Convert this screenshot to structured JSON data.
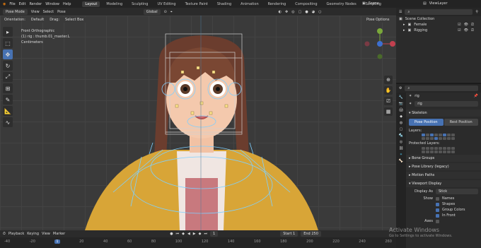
{
  "menus": [
    "File",
    "Edit",
    "Render",
    "Window",
    "Help"
  ],
  "workspace_tabs": [
    {
      "label": "Layout",
      "active": true
    },
    {
      "label": "Modeling"
    },
    {
      "label": "Sculpting"
    },
    {
      "label": "UV Editing"
    },
    {
      "label": "Texture Paint"
    },
    {
      "label": "Shading"
    },
    {
      "label": "Animation"
    },
    {
      "label": "Rendering"
    },
    {
      "label": "Compositing"
    },
    {
      "label": "Geometry Nodes"
    },
    {
      "label": "Scripting"
    }
  ],
  "scene": {
    "label": "Scene",
    "view_layer": "ViewLayer"
  },
  "viewport_header": {
    "mode": "Pose Mode",
    "view": "View",
    "select": "Select",
    "pose": "Pose",
    "transform": "Global",
    "orientation_label": "Orientation:",
    "orientation_value": "Default",
    "drag_label": "Drag:",
    "drag_value": "Select Box",
    "pose_options": "Pose Options"
  },
  "viewport_overlay": {
    "view_name": "Front Orthographic",
    "object_line": "(1) rig : thumb.01_master.L",
    "units": "Centimeters"
  },
  "outliner": {
    "root": "Scene Collection",
    "items": [
      "Female",
      "Rigging"
    ]
  },
  "properties": {
    "object": "rig",
    "data": "rig",
    "skeleton": {
      "title": "Skeleton",
      "pose_position": "Pose Position",
      "rest_position": "Rest Position",
      "layers": "Layers:",
      "protected_layers": "Protected Layers:"
    },
    "collapsed": [
      "Bone Groups",
      "Pose Library (legacy)",
      "Motion Paths"
    ],
    "viewport_display": {
      "title": "Viewport Display",
      "display_as_label": "Display As",
      "display_as_value": "Stick",
      "show_label": "Show",
      "options": [
        "Names",
        "Shapes",
        "Group Colors",
        "In Front"
      ],
      "axes": "Axes"
    }
  },
  "timeline": {
    "menus": [
      "Playback",
      "Keying",
      "View",
      "Marker"
    ],
    "current_frame": "1",
    "start_label": "Start",
    "start_value": "1",
    "end_label": "End",
    "end_value": "250",
    "ticks": [
      "-40",
      "-20",
      "1",
      "20",
      "40",
      "60",
      "80",
      "100",
      "120",
      "140",
      "160",
      "180",
      "200",
      "220",
      "240",
      "260"
    ]
  },
  "watermark": {
    "line1": "Activate Windows",
    "line2": "Go to Settings to activate Windows."
  },
  "colors": {
    "accent": "#4772b3",
    "bg": "#1d1d1d",
    "panel": "#2b2b2b",
    "viewport": "#3a3a3a"
  }
}
